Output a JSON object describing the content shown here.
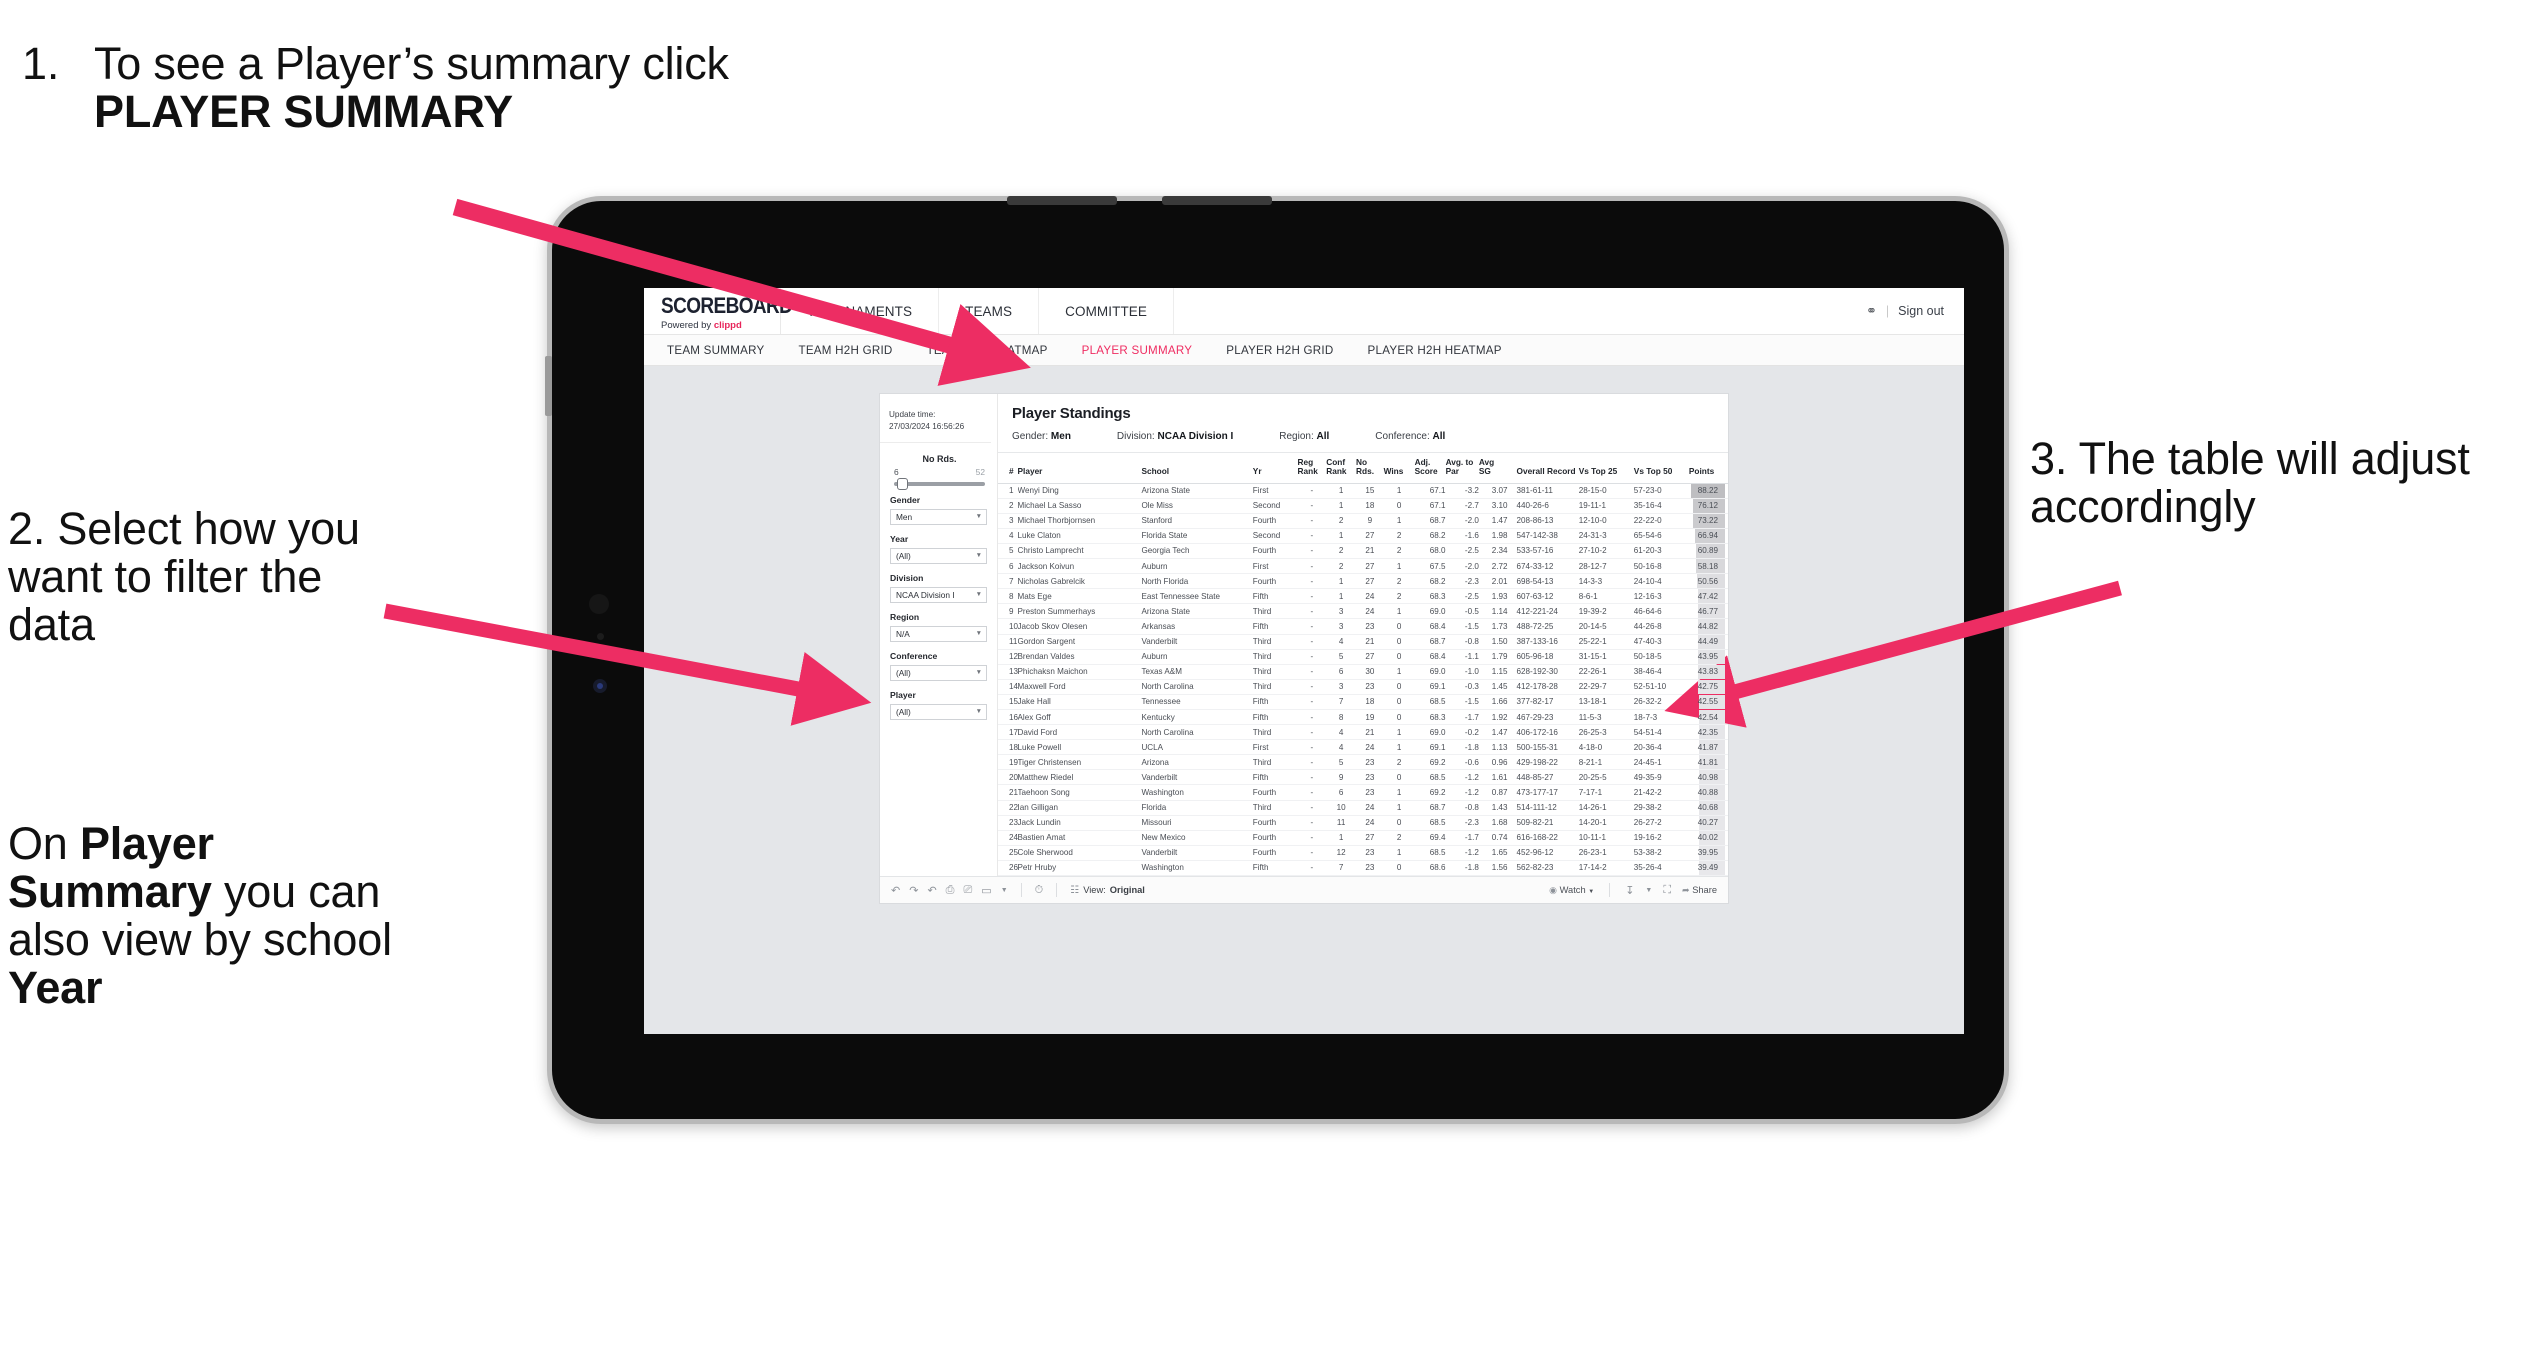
{
  "annotations": {
    "one": {
      "number": "1.",
      "text_before": "To see a Player’s summary click ",
      "bold": "PLAYER SUMMARY"
    },
    "two": {
      "line": "2. Select how you want to filter the data"
    },
    "two_b": {
      "p1": "On ",
      "b1": "Player Summary",
      "p2": " you can also view by school ",
      "b2": "Year"
    },
    "three": {
      "line": "3. The table will adjust accordingly"
    },
    "arrow_color": "#ED2D63"
  },
  "app": {
    "logo": {
      "word": "SCOREBOARD",
      "sub_prefix": "Powered by ",
      "sub_brand": "clippd"
    },
    "topnav": [
      "TOURNAMENTS",
      "TEAMS",
      "COMMITTEE"
    ],
    "header_right": {
      "account_icon": "user-icon",
      "separator": "|",
      "sign_out": "Sign out"
    },
    "subnav": {
      "items": [
        "TEAM SUMMARY",
        "TEAM H2H GRID",
        "TEAM H2H HEATMAP",
        "PLAYER SUMMARY",
        "PLAYER H2H GRID",
        "PLAYER H2H HEATMAP"
      ],
      "active": "PLAYER SUMMARY",
      "active_color": "#EF2D62"
    }
  },
  "viz": {
    "update_time_label": "Update time:",
    "update_time_value": "27/03/2024 16:56:26",
    "title": "Player Standings",
    "header_filters": [
      {
        "label": "Gender:",
        "value": "Men"
      },
      {
        "label": "Division:",
        "value": "NCAA Division I"
      },
      {
        "label": "Region:",
        "value": "All"
      },
      {
        "label": "Conference:",
        "value": "All"
      }
    ],
    "slider": {
      "title": "No Rds.",
      "min": "6",
      "max": "52"
    },
    "filters": [
      {
        "label": "Gender",
        "value": "Men"
      },
      {
        "label": "Year",
        "value": "(All)"
      },
      {
        "label": "Division",
        "value": "NCAA Division I"
      },
      {
        "label": "Region",
        "value": "N/A"
      },
      {
        "label": "Conference",
        "value": "(All)"
      },
      {
        "label": "Player",
        "value": "(All)"
      }
    ],
    "toolbar": {
      "icons": [
        "undo-icon",
        "redo-icon",
        "revert-icon",
        "refresh-icon",
        "pause-icon",
        "rectangle-select-icon",
        "chevron-down-icon",
        "dashboard-icon"
      ],
      "view_label": "View:",
      "view_value": "Original",
      "watch_label": "Watch",
      "download_icon": "download-icon",
      "fullscreen_icon": "fullscreen-icon",
      "share_label": "Share"
    },
    "table": {
      "columns": [
        "#",
        "Player",
        "School",
        "Yr",
        "Reg Rank",
        "Conf Rank",
        "No Rds.",
        "Wins",
        "Adj. Score",
        "Avg. to Par",
        "Avg SG",
        "Overall Record",
        "Vs Top 25",
        "Vs Top 50",
        "Points"
      ],
      "rows": [
        [
          "1",
          "Wenyi Ding",
          "Arizona State",
          "First",
          "-",
          "1",
          "15",
          "1",
          "67.1",
          "-3.2",
          "3.07",
          "381-61-11",
          "28-15-0",
          "57-23-0",
          "88.22"
        ],
        [
          "2",
          "Michael La Sasso",
          "Ole Miss",
          "Second",
          "-",
          "1",
          "18",
          "0",
          "67.1",
          "-2.7",
          "3.10",
          "440-26-6",
          "19-11-1",
          "35-16-4",
          "76.12"
        ],
        [
          "3",
          "Michael Thorbjornsen",
          "Stanford",
          "Fourth",
          "-",
          "2",
          "9",
          "1",
          "68.7",
          "-2.0",
          "1.47",
          "208-86-13",
          "12-10-0",
          "22-22-0",
          "73.22"
        ],
        [
          "4",
          "Luke Claton",
          "Florida State",
          "Second",
          "-",
          "1",
          "27",
          "2",
          "68.2",
          "-1.6",
          "1.98",
          "547-142-38",
          "24-31-3",
          "65-54-6",
          "66.94"
        ],
        [
          "5",
          "Christo Lamprecht",
          "Georgia Tech",
          "Fourth",
          "-",
          "2",
          "21",
          "2",
          "68.0",
          "-2.5",
          "2.34",
          "533-57-16",
          "27-10-2",
          "61-20-3",
          "60.89"
        ],
        [
          "6",
          "Jackson Koivun",
          "Auburn",
          "First",
          "-",
          "2",
          "27",
          "1",
          "67.5",
          "-2.0",
          "2.72",
          "674-33-12",
          "28-12-7",
          "50-16-8",
          "58.18"
        ],
        [
          "7",
          "Nicholas Gabrelcik",
          "North Florida",
          "Fourth",
          "-",
          "1",
          "27",
          "2",
          "68.2",
          "-2.3",
          "2.01",
          "698-54-13",
          "14-3-3",
          "24-10-4",
          "50.56"
        ],
        [
          "8",
          "Mats Ege",
          "East Tennessee State",
          "Fifth",
          "-",
          "1",
          "24",
          "2",
          "68.3",
          "-2.5",
          "1.93",
          "607-63-12",
          "8-6-1",
          "12-16-3",
          "47.42"
        ],
        [
          "9",
          "Preston Summerhays",
          "Arizona State",
          "Third",
          "-",
          "3",
          "24",
          "1",
          "69.0",
          "-0.5",
          "1.14",
          "412-221-24",
          "19-39-2",
          "46-64-6",
          "46.77"
        ],
        [
          "10",
          "Jacob Skov Olesen",
          "Arkansas",
          "Fifth",
          "-",
          "3",
          "23",
          "0",
          "68.4",
          "-1.5",
          "1.73",
          "488-72-25",
          "20-14-5",
          "44-26-8",
          "44.82"
        ],
        [
          "11",
          "Gordon Sargent",
          "Vanderbilt",
          "Third",
          "-",
          "4",
          "21",
          "0",
          "68.7",
          "-0.8",
          "1.50",
          "387-133-16",
          "25-22-1",
          "47-40-3",
          "44.49"
        ],
        [
          "12",
          "Brendan Valdes",
          "Auburn",
          "Third",
          "-",
          "5",
          "27",
          "0",
          "68.4",
          "-1.1",
          "1.79",
          "605-96-18",
          "31-15-1",
          "50-18-5",
          "43.95"
        ],
        [
          "13",
          "Phichaksn Maichon",
          "Texas A&M",
          "Third",
          "-",
          "6",
          "30",
          "1",
          "69.0",
          "-1.0",
          "1.15",
          "628-192-30",
          "22-26-1",
          "38-46-4",
          "43.83"
        ],
        [
          "14",
          "Maxwell Ford",
          "North Carolina",
          "Third",
          "-",
          "3",
          "23",
          "0",
          "69.1",
          "-0.3",
          "1.45",
          "412-178-28",
          "22-29-7",
          "52-51-10",
          "42.75"
        ],
        [
          "15",
          "Jake Hall",
          "Tennessee",
          "Fifth",
          "-",
          "7",
          "18",
          "0",
          "68.5",
          "-1.5",
          "1.66",
          "377-82-17",
          "13-18-1",
          "26-32-2",
          "42.55"
        ],
        [
          "16",
          "Alex Goff",
          "Kentucky",
          "Fifth",
          "-",
          "8",
          "19",
          "0",
          "68.3",
          "-1.7",
          "1.92",
          "467-29-23",
          "11-5-3",
          "18-7-3",
          "42.54"
        ],
        [
          "17",
          "David Ford",
          "North Carolina",
          "Third",
          "-",
          "4",
          "21",
          "1",
          "69.0",
          "-0.2",
          "1.47",
          "406-172-16",
          "26-25-3",
          "54-51-4",
          "42.35"
        ],
        [
          "18",
          "Luke Powell",
          "UCLA",
          "First",
          "-",
          "4",
          "24",
          "1",
          "69.1",
          "-1.8",
          "1.13",
          "500-155-31",
          "4-18-0",
          "20-36-4",
          "41.87"
        ],
        [
          "19",
          "Tiger Christensen",
          "Arizona",
          "Third",
          "-",
          "5",
          "23",
          "2",
          "69.2",
          "-0.6",
          "0.96",
          "429-198-22",
          "8-21-1",
          "24-45-1",
          "41.81"
        ],
        [
          "20",
          "Matthew Riedel",
          "Vanderbilt",
          "Fifth",
          "-",
          "9",
          "23",
          "0",
          "68.5",
          "-1.2",
          "1.61",
          "448-85-27",
          "20-25-5",
          "49-35-9",
          "40.98"
        ],
        [
          "21",
          "Taehoon Song",
          "Washington",
          "Fourth",
          "-",
          "6",
          "23",
          "1",
          "69.2",
          "-1.2",
          "0.87",
          "473-177-17",
          "7-17-1",
          "21-42-2",
          "40.88"
        ],
        [
          "22",
          "Ian Gilligan",
          "Florida",
          "Third",
          "-",
          "10",
          "24",
          "1",
          "68.7",
          "-0.8",
          "1.43",
          "514-111-12",
          "14-26-1",
          "29-38-2",
          "40.68"
        ],
        [
          "23",
          "Jack Lundin",
          "Missouri",
          "Fourth",
          "-",
          "11",
          "24",
          "0",
          "68.5",
          "-2.3",
          "1.68",
          "509-82-21",
          "14-20-1",
          "26-27-2",
          "40.27"
        ],
        [
          "24",
          "Bastien Amat",
          "New Mexico",
          "Fourth",
          "-",
          "1",
          "27",
          "2",
          "69.4",
          "-1.7",
          "0.74",
          "616-168-22",
          "10-11-1",
          "19-16-2",
          "40.02"
        ],
        [
          "25",
          "Cole Sherwood",
          "Vanderbilt",
          "Fourth",
          "-",
          "12",
          "23",
          "1",
          "68.5",
          "-1.2",
          "1.65",
          "452-96-12",
          "26-23-1",
          "53-38-2",
          "39.95"
        ],
        [
          "26",
          "Petr Hruby",
          "Washington",
          "Fifth",
          "-",
          "7",
          "23",
          "0",
          "68.6",
          "-1.8",
          "1.56",
          "562-82-23",
          "17-14-2",
          "35-26-4",
          "39.49"
        ]
      ]
    }
  }
}
